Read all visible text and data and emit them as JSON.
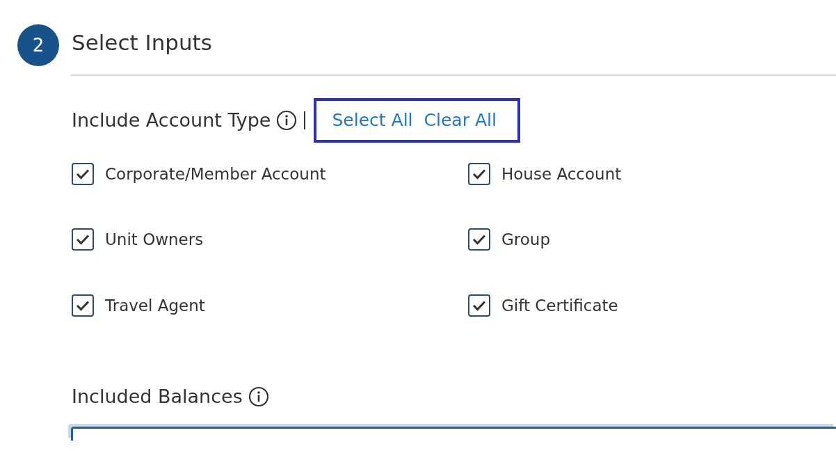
{
  "step": {
    "number": "2",
    "title": "Select Inputs"
  },
  "account_type": {
    "label": "Include Account Type",
    "actions": [
      "Select All",
      "Clear All"
    ],
    "highlighted": true,
    "options": [
      {
        "label": "Corporate/Member Account",
        "checked": true
      },
      {
        "label": "House Account",
        "checked": true
      },
      {
        "label": "Unit Owners",
        "checked": true
      },
      {
        "label": "Group",
        "checked": true
      },
      {
        "label": "Travel Agent",
        "checked": true
      },
      {
        "label": "Gift Certificate",
        "checked": true
      }
    ]
  },
  "included_balances": {
    "label": "Included Balances"
  }
}
